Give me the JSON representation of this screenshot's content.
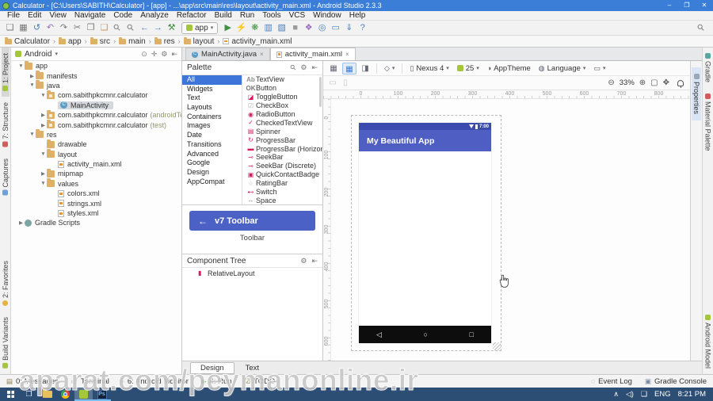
{
  "window": {
    "title": "Calculator - [C:\\Users\\SABITH\\Calculator] - [app] - ...\\app\\src\\main\\res\\layout\\activity_main.xml - Android Studio 2.3.3",
    "minimize": "–",
    "maximize": "❐",
    "close": "✕"
  },
  "menu": [
    "File",
    "Edit",
    "View",
    "Navigate",
    "Code",
    "Analyze",
    "Refactor",
    "Build",
    "Run",
    "Tools",
    "VCS",
    "Window",
    "Help"
  ],
  "icons": {
    "caret": "▾",
    "search": "⚲",
    "gear": "⚙",
    "hide": "⇤",
    "collapse": "⊙",
    "locate": "✛",
    "zoom_out": "⊖",
    "zoom_in": "⊕",
    "fit": "▢",
    "pan": "✥",
    "orientation": "◇",
    "fragment": "▭",
    "device_glyph": "▯",
    "theme_glyph": "◑",
    "globe_glyph": "◍"
  },
  "toolbar": {
    "run_config": "app",
    "left": [
      {
        "g": "❏",
        "n": "open-icon"
      },
      {
        "g": "▦",
        "n": "save-icon"
      },
      {
        "g": "↺",
        "n": "sync-icon",
        "c": "tb-blue"
      },
      {
        "g": "↶",
        "n": "undo-icon",
        "c": "tb-purple"
      },
      {
        "g": "↷",
        "n": "redo-icon"
      },
      {
        "g": "✂",
        "n": "cut-icon"
      },
      {
        "g": "❐",
        "n": "copy-icon"
      },
      {
        "g": "❑",
        "n": "paste-icon",
        "c": "tb-tan"
      },
      {
        "g": "⚲",
        "n": "find-icon",
        "c": "rot"
      },
      {
        "g": "⚲",
        "n": "replace-icon",
        "c": "rot"
      },
      {
        "g": "←",
        "n": "back-icon",
        "c": "tb-blue"
      },
      {
        "g": "→",
        "n": "forward-icon",
        "c": "tb-blue"
      },
      {
        "g": "⚒",
        "n": "build-icon",
        "c": "tb-green"
      }
    ],
    "right": [
      {
        "g": "▶",
        "n": "run-icon",
        "c": "tb-green"
      },
      {
        "g": "⚡",
        "n": "profile-icon",
        "c": "tb-amber"
      },
      {
        "g": "❋",
        "n": "debug-icon",
        "c": "tb-green"
      },
      {
        "g": "▥",
        "n": "coverage-icon",
        "c": "tb-blue"
      },
      {
        "g": "▧",
        "n": "attach-debugger-icon",
        "c": "tb-blue"
      },
      {
        "g": "■",
        "n": "stop-icon",
        "c": "tb-gray"
      },
      {
        "g": "❖",
        "n": "layout-capture-icon",
        "c": "tb-purple"
      },
      {
        "g": "◎",
        "n": "screen-record-icon",
        "c": "tb-blue"
      },
      {
        "g": "▭",
        "n": "device-monitor-icon",
        "c": "tb-blue"
      },
      {
        "g": "⇓",
        "n": "sdk-manager-icon",
        "c": "tb-blue"
      },
      {
        "g": "?",
        "n": "help-icon",
        "c": "tb-blue"
      }
    ]
  },
  "breadcrumbs": [
    {
      "label": "Calculator",
      "c": "bc-folder",
      "sep": "›"
    },
    {
      "label": "app",
      "c": "bc-folder",
      "sep": "›"
    },
    {
      "label": "src",
      "c": "bc-folder",
      "sep": "›"
    },
    {
      "label": "main",
      "c": "bc-folder",
      "sep": "›"
    },
    {
      "label": "res",
      "c": "bc-folder",
      "sep": "›"
    },
    {
      "label": "layout",
      "c": "bc-folder",
      "sep": "›"
    },
    {
      "label": "activity_main.xml",
      "c": "bc-xml",
      "sep": ""
    }
  ],
  "left_strip": {
    "top": [
      {
        "label": "1: Project",
        "ic": "st-android",
        "state": "sel"
      },
      {
        "label": "7: Structure",
        "ic": "st-red"
      },
      {
        "label": "Captures",
        "ic": "st-blue"
      }
    ],
    "bottom": [
      {
        "label": "2: Favorites",
        "ic": "st-star"
      },
      {
        "label": "Build Variants",
        "ic": "st-android"
      }
    ]
  },
  "right_strip": {
    "inner": [
      {
        "label": "Properties",
        "ic": "st-gray"
      }
    ],
    "top": [
      {
        "label": "Gradle",
        "ic": "st-teal"
      },
      {
        "label": "Material Palette",
        "ic": "st-red"
      }
    ],
    "bottom": [
      {
        "label": "Android Model",
        "ic": "st-android"
      }
    ]
  },
  "project": {
    "view": "Android",
    "tree": [
      {
        "arrow": "▼",
        "ic": "ic-folder",
        "label": "app",
        "d": "d0"
      },
      {
        "arrow": "▶",
        "ic": "ic-folder",
        "label": "manifests",
        "d": "d1"
      },
      {
        "arrow": "▼",
        "ic": "ic-folder",
        "label": "java",
        "d": "d1"
      },
      {
        "arrow": "▼",
        "ic": "ic-pkg",
        "label": "com.sabithpkcmnr.calculator",
        "d": "d2"
      },
      {
        "arrow": "",
        "ic": "ic-class",
        "label": "MainActivity",
        "d": "d3",
        "state": "sel"
      },
      {
        "arrow": "▶",
        "ic": "ic-pkg",
        "label": "com.sabithpkcmnr.calculator",
        "suffix": "(androidTest)",
        "d": "d2"
      },
      {
        "arrow": "▶",
        "ic": "ic-pkg",
        "label": "com.sabithpkcmnr.calculator",
        "suffix": "(test)",
        "d": "d2"
      },
      {
        "arrow": "▼",
        "ic": "ic-folder",
        "label": "res",
        "d": "d1"
      },
      {
        "arrow": "",
        "ic": "ic-folder",
        "label": "drawable",
        "d": "d2"
      },
      {
        "arrow": "▼",
        "ic": "ic-folder",
        "label": "layout",
        "d": "d2"
      },
      {
        "arrow": "",
        "ic": "ic-xml",
        "label": "activity_main.xml",
        "d": "d3"
      },
      {
        "arrow": "▶",
        "ic": "ic-folder",
        "label": "mipmap",
        "d": "d2"
      },
      {
        "arrow": "▼",
        "ic": "ic-folder",
        "label": "values",
        "d": "d2"
      },
      {
        "arrow": "",
        "ic": "ic-xml",
        "label": "colors.xml",
        "d": "d3"
      },
      {
        "arrow": "",
        "ic": "ic-xml",
        "label": "strings.xml",
        "d": "d3"
      },
      {
        "arrow": "",
        "ic": "ic-xml",
        "label": "styles.xml",
        "d": "d3"
      },
      {
        "arrow": "▶",
        "ic": "ic-gradle",
        "label": "Gradle Scripts",
        "d": "d0"
      }
    ]
  },
  "editor_tabs": [
    {
      "label": "MainActivity.java",
      "ic": "tic-class",
      "x": "×"
    },
    {
      "label": "activity_main.xml",
      "ic": "tic-xml",
      "x": "×",
      "state": "active"
    }
  ],
  "palette": {
    "title": "Palette",
    "categories": [
      {
        "label": "All",
        "state": "sel"
      },
      {
        "label": "Widgets"
      },
      {
        "label": "Text"
      },
      {
        "label": "Layouts"
      },
      {
        "label": "Containers"
      },
      {
        "label": "Images"
      },
      {
        "label": "Date"
      },
      {
        "label": "Transitions"
      },
      {
        "label": "Advanced"
      },
      {
        "label": "Google"
      },
      {
        "label": "Design"
      },
      {
        "label": "AppCompat"
      }
    ],
    "widgets": [
      {
        "g": "Ab",
        "c": "wi-ab",
        "label": "TextView"
      },
      {
        "g": "OK",
        "c": "wi-ok",
        "label": "Button"
      },
      {
        "g": "◪",
        "c": "wi-pink",
        "label": "ToggleButton"
      },
      {
        "g": "☑",
        "c": "wi-lgray",
        "label": "CheckBox"
      },
      {
        "g": "◉",
        "c": "wi-red",
        "label": "RadioButton"
      },
      {
        "g": "✓",
        "c": "wi-red",
        "label": "CheckedTextView"
      },
      {
        "g": "▤",
        "c": "wi-pink",
        "label": "Spinner"
      },
      {
        "g": "↻",
        "c": "wi-red",
        "label": "ProgressBar"
      },
      {
        "g": "▬",
        "c": "wi-red",
        "label": "ProgressBar (Horizontal)"
      },
      {
        "g": "⊸",
        "c": "wi-red",
        "label": "SeekBar"
      },
      {
        "g": "⊸",
        "c": "wi-red",
        "label": "SeekBar (Discrete)"
      },
      {
        "g": "▣",
        "c": "wi-red",
        "label": "QuickContactBadge"
      },
      {
        "g": "☆",
        "c": "wi-lgray",
        "label": "RatingBar"
      },
      {
        "g": "⊷",
        "c": "wi-red",
        "label": "Switch"
      },
      {
        "g": "↔",
        "c": "wi-ab",
        "label": "Space"
      }
    ],
    "preview_back": "←",
    "preview_title": "v7 Toolbar",
    "preview_caption": "Toolbar"
  },
  "component_tree": {
    "title": "Component Tree",
    "items": [
      {
        "g": "▮",
        "label": "RelativeLayout"
      }
    ]
  },
  "design_toolbar": {
    "modes": [
      {
        "g": "▦",
        "n": "design-mode-icon"
      },
      {
        "g": "▦",
        "n": "blueprint-mode-icon",
        "state": "mode-sel"
      },
      {
        "g": "◨",
        "n": "split-mode-icon"
      }
    ],
    "disabled": [
      {
        "g": "▭"
      },
      {
        "g": "▯"
      }
    ],
    "device": "Nexus 4",
    "api": "25",
    "theme": "AppTheme",
    "language": "Language",
    "zoom": "33%"
  },
  "rulers": {
    "h": [
      "0",
      "100",
      "200",
      "300",
      "400",
      "500",
      "600",
      "700",
      "800"
    ],
    "v": [
      "0",
      "100",
      "200",
      "300",
      "400",
      "500",
      "600"
    ]
  },
  "device": {
    "time": "7:00",
    "app_title": "My Beautiful App",
    "nav": [
      "◁",
      "○",
      "□"
    ]
  },
  "bottom_tabs": [
    {
      "label": "Design",
      "state": "active"
    },
    {
      "label": "Text"
    }
  ],
  "status_bar": {
    "left": [
      {
        "g": "▤",
        "label": "0: Messages"
      },
      {
        "g": "▭",
        "label": "Terminal"
      },
      {
        "g": "▪",
        "c": "sb-green",
        "label": "6: Android Monitor"
      },
      {
        "g": "▶",
        "c": "sb-green",
        "label": "4: Run"
      },
      {
        "g": "☑",
        "label": "TODO"
      }
    ],
    "right": [
      {
        "g": "◌",
        "label": "Event Log"
      },
      {
        "g": "▣",
        "label": "Gradle Console"
      }
    ]
  },
  "taskbar": {
    "ps": "Ps",
    "tray_up": "∧",
    "volume": "◁)",
    "chat": "❑",
    "lang": "ENG",
    "time": "8:21 PM"
  },
  "watermark": "aparat.com/peymanonline.ir"
}
